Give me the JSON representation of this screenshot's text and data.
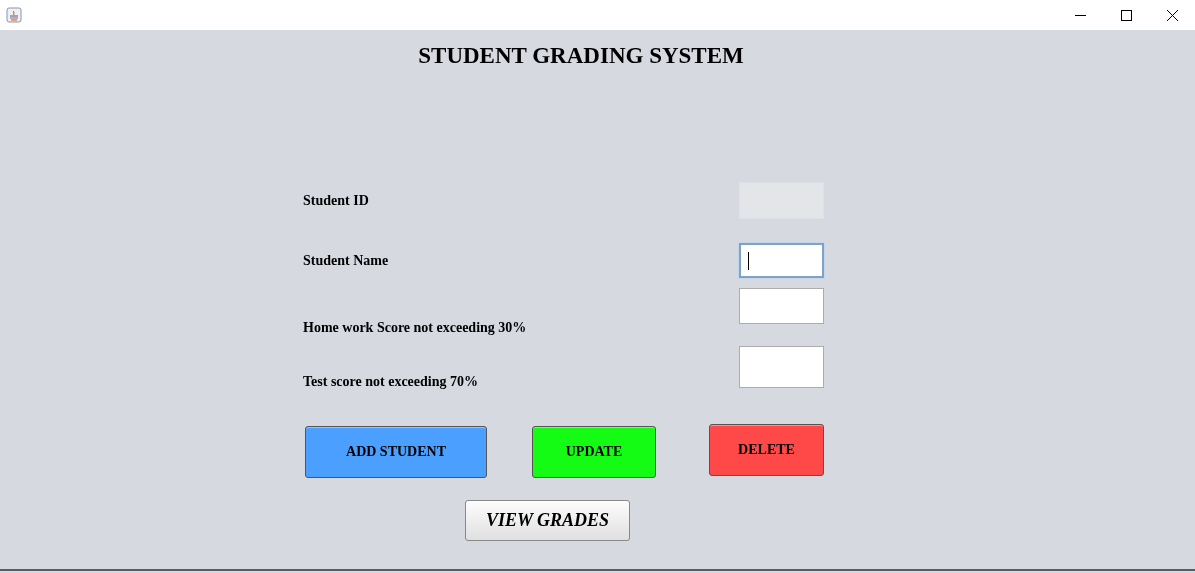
{
  "window": {
    "title": "STUDENT GRADING SYSTEM"
  },
  "fields": [
    {
      "label": "Student ID",
      "disabled": true,
      "focused": false
    },
    {
      "label": "Student Name",
      "disabled": false,
      "focused": true
    },
    {
      "label": "Home work Score not exceeding 30%",
      "disabled": false,
      "focused": false
    },
    {
      "label": "Test score not exceeding 70%",
      "disabled": false,
      "focused": false
    }
  ],
  "buttons": [
    {
      "label": "ADD STUDENT",
      "color": "#4ba0ff"
    },
    {
      "label": "UPDATE",
      "color": "#14fb14"
    },
    {
      "label": "DELETE",
      "color": "#ff4848"
    }
  ],
  "view_button": {
    "label": "VIEW GRADES"
  }
}
